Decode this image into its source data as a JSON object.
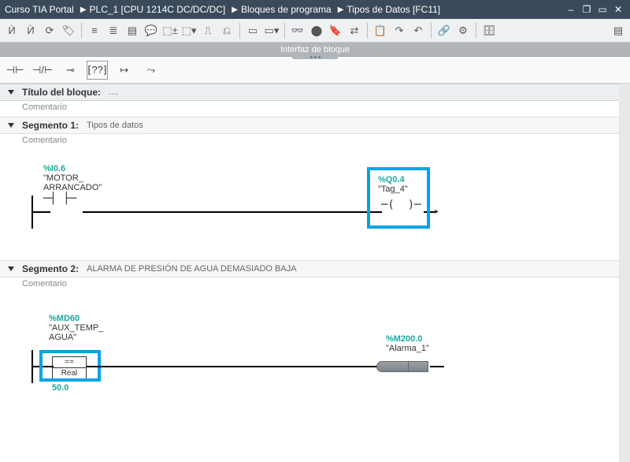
{
  "titlebar": {
    "crumbs": [
      "Curso TIA Portal",
      "PLC_1 [CPU 1214C DC/DC/DC]",
      "Bloques de programa",
      "Tipos de Datos [FC11]"
    ]
  },
  "interface_label": "Interfaz de bloque",
  "block": {
    "title_label": "Título del bloque:",
    "title_value": "....",
    "comment": "Comentario"
  },
  "quickbar": {
    "items": [
      "⊣⊢",
      "⊣/⊢",
      "⊸",
      "⁅??⁆",
      "↦",
      "⤳"
    ]
  },
  "segments": [
    {
      "label": "Segmento 1:",
      "subtitle": "Tipos de datos",
      "comment": "Comentario",
      "left": {
        "addr": "%I0.6",
        "tag": "\"MOTOR_\nARRANCADO\""
      },
      "right": {
        "addr": "%Q0.4",
        "tag": "\"Tag_4\""
      }
    },
    {
      "label": "Segmento 2:",
      "subtitle": "ALARMA DE PRESIÓN DE AGUA DEMASIADO BAJA",
      "comment": "Comentario",
      "left": {
        "addr": "%MD60",
        "tag": "\"AUX_TEMP_\nAGUA\"",
        "cmp_top": "==",
        "cmp_bot": "Real",
        "val": "50.0"
      },
      "right": {
        "addr": "%M200.0",
        "tag": "\"Alarma_1\""
      }
    }
  ]
}
